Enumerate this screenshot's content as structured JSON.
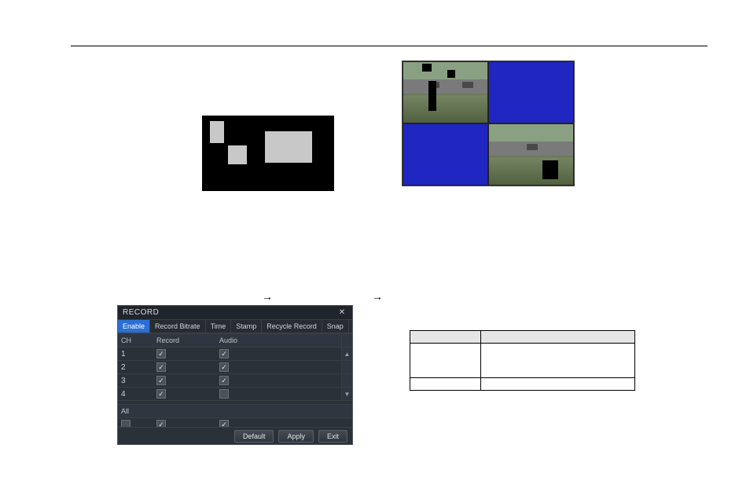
{
  "arrows": {
    "a1": "→",
    "a2": "→"
  },
  "dialog": {
    "title": "RECORD",
    "close_icon": "✕",
    "tabs": [
      "Enable",
      "Record Bitrate",
      "Time",
      "Stamp",
      "Recycle Record",
      "Snap"
    ],
    "columns": {
      "ch": "CH",
      "record": "Record",
      "audio": "Audio"
    },
    "rows": [
      {
        "ch": "1",
        "record": true,
        "audio": true,
        "scroll_glyph": "▲"
      },
      {
        "ch": "2",
        "record": true,
        "audio": true,
        "scroll_glyph": ""
      },
      {
        "ch": "3",
        "record": true,
        "audio": true,
        "scroll_glyph": ""
      },
      {
        "ch": "4",
        "record": true,
        "audio": false,
        "scroll_glyph": "▼"
      }
    ],
    "all_label": "All",
    "all_row": {
      "enable": false,
      "record": true,
      "audio": true
    },
    "buttons": {
      "default": "Default",
      "apply": "Apply",
      "exit": "Exit"
    }
  },
  "check_glyph": "✓",
  "param_table": {
    "header": {
      "param": "",
      "meaning": ""
    },
    "rows": [
      {
        "param": "",
        "meaning": ""
      },
      {
        "param": "",
        "meaning": ""
      }
    ]
  }
}
